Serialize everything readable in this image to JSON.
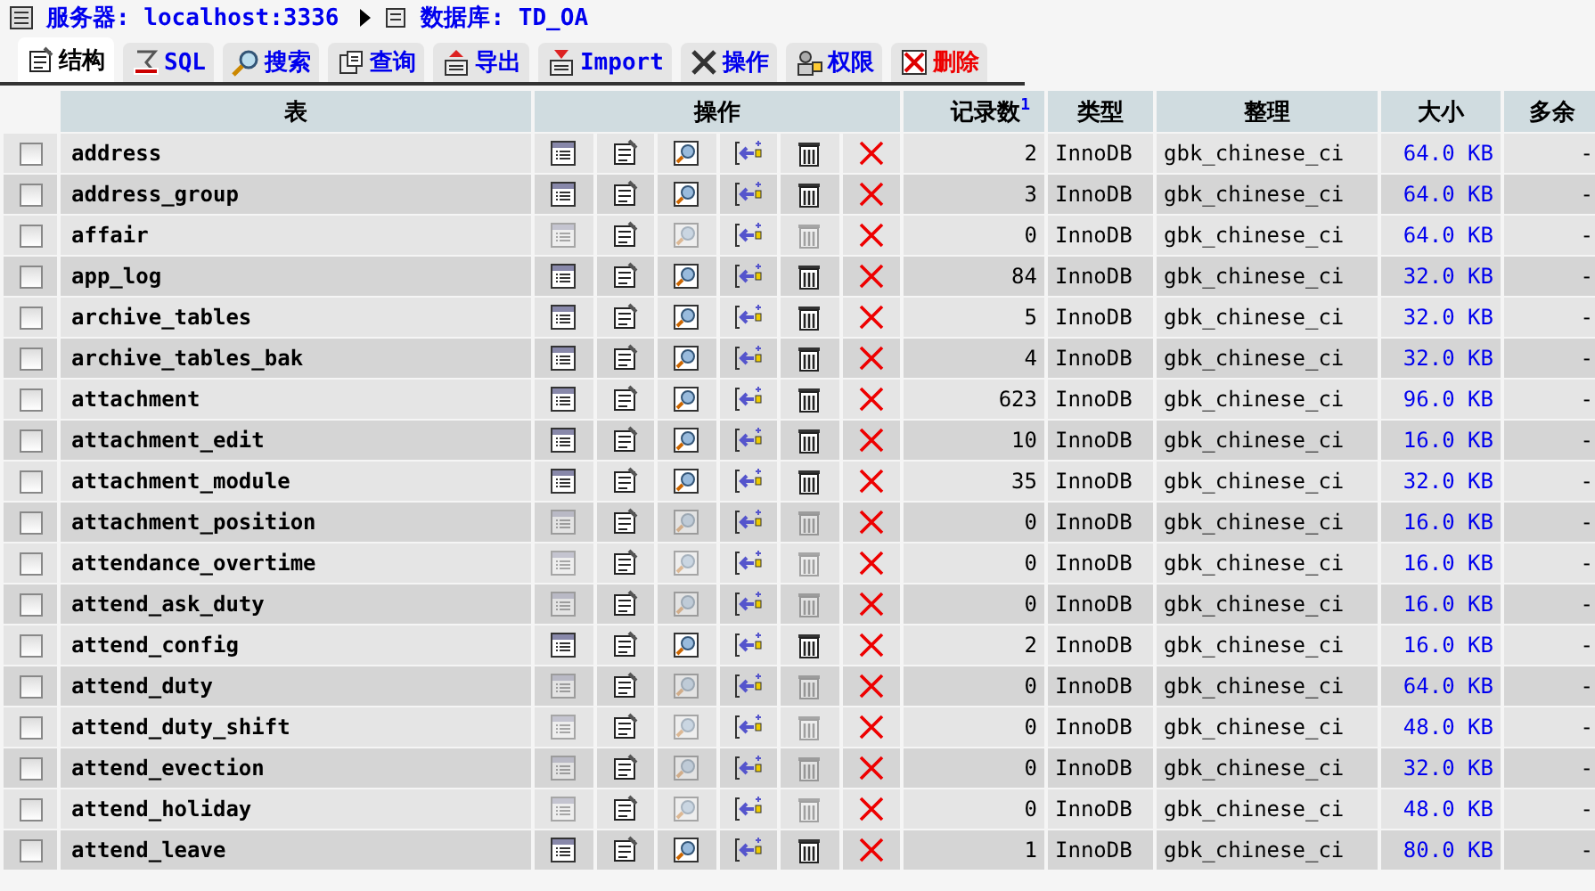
{
  "breadcrumb": {
    "server_label": "服务器: localhost:3336",
    "database_label": "数据库: TD_OA"
  },
  "tabs": [
    {
      "label": "结构",
      "selected": true,
      "kind": "structure"
    },
    {
      "label": "SQL",
      "selected": false,
      "kind": "sql"
    },
    {
      "label": "搜索",
      "selected": false,
      "kind": "search"
    },
    {
      "label": "查询",
      "selected": false,
      "kind": "query"
    },
    {
      "label": "导出",
      "selected": false,
      "kind": "export"
    },
    {
      "label": "Import",
      "selected": false,
      "kind": "import"
    },
    {
      "label": "操作",
      "selected": false,
      "kind": "operations"
    },
    {
      "label": "权限",
      "selected": false,
      "kind": "privileges"
    },
    {
      "label": "删除",
      "selected": false,
      "kind": "drop"
    }
  ],
  "table": {
    "columns": [
      {
        "label": "表"
      },
      {
        "label": "操作"
      },
      {
        "label": "记录数",
        "note": "1"
      },
      {
        "label": "类型"
      },
      {
        "label": "整理"
      },
      {
        "label": "大小"
      },
      {
        "label": "多余"
      }
    ],
    "rows": [
      {
        "name": "address",
        "checked": false,
        "empty": false,
        "records": "2",
        "type": "InnoDB",
        "collation": "gbk_chinese_ci",
        "size": "64.0 KB",
        "overhead": "-"
      },
      {
        "name": "address_group",
        "checked": false,
        "empty": false,
        "records": "3",
        "type": "InnoDB",
        "collation": "gbk_chinese_ci",
        "size": "64.0 KB",
        "overhead": "-"
      },
      {
        "name": "affair",
        "checked": false,
        "empty": true,
        "records": "0",
        "type": "InnoDB",
        "collation": "gbk_chinese_ci",
        "size": "64.0 KB",
        "overhead": "-"
      },
      {
        "name": "app_log",
        "checked": false,
        "empty": false,
        "records": "84",
        "type": "InnoDB",
        "collation": "gbk_chinese_ci",
        "size": "32.0 KB",
        "overhead": "-"
      },
      {
        "name": "archive_tables",
        "checked": false,
        "empty": false,
        "records": "5",
        "type": "InnoDB",
        "collation": "gbk_chinese_ci",
        "size": "32.0 KB",
        "overhead": "-"
      },
      {
        "name": "archive_tables_bak",
        "checked": false,
        "empty": false,
        "records": "4",
        "type": "InnoDB",
        "collation": "gbk_chinese_ci",
        "size": "32.0 KB",
        "overhead": "-"
      },
      {
        "name": "attachment",
        "checked": false,
        "empty": false,
        "records": "623",
        "type": "InnoDB",
        "collation": "gbk_chinese_ci",
        "size": "96.0 KB",
        "overhead": "-"
      },
      {
        "name": "attachment_edit",
        "checked": false,
        "empty": false,
        "records": "10",
        "type": "InnoDB",
        "collation": "gbk_chinese_ci",
        "size": "16.0 KB",
        "overhead": "-"
      },
      {
        "name": "attachment_module",
        "checked": false,
        "empty": false,
        "records": "35",
        "type": "InnoDB",
        "collation": "gbk_chinese_ci",
        "size": "32.0 KB",
        "overhead": "-"
      },
      {
        "name": "attachment_position",
        "checked": false,
        "empty": true,
        "records": "0",
        "type": "InnoDB",
        "collation": "gbk_chinese_ci",
        "size": "16.0 KB",
        "overhead": "-"
      },
      {
        "name": "attendance_overtime",
        "checked": false,
        "empty": true,
        "records": "0",
        "type": "InnoDB",
        "collation": "gbk_chinese_ci",
        "size": "16.0 KB",
        "overhead": "-"
      },
      {
        "name": "attend_ask_duty",
        "checked": false,
        "empty": true,
        "records": "0",
        "type": "InnoDB",
        "collation": "gbk_chinese_ci",
        "size": "16.0 KB",
        "overhead": "-"
      },
      {
        "name": "attend_config",
        "checked": false,
        "empty": false,
        "records": "2",
        "type": "InnoDB",
        "collation": "gbk_chinese_ci",
        "size": "16.0 KB",
        "overhead": "-"
      },
      {
        "name": "attend_duty",
        "checked": false,
        "empty": true,
        "records": "0",
        "type": "InnoDB",
        "collation": "gbk_chinese_ci",
        "size": "64.0 KB",
        "overhead": "-"
      },
      {
        "name": "attend_duty_shift",
        "checked": false,
        "empty": true,
        "records": "0",
        "type": "InnoDB",
        "collation": "gbk_chinese_ci",
        "size": "48.0 KB",
        "overhead": "-"
      },
      {
        "name": "attend_evection",
        "checked": false,
        "empty": true,
        "records": "0",
        "type": "InnoDB",
        "collation": "gbk_chinese_ci",
        "size": "32.0 KB",
        "overhead": "-"
      },
      {
        "name": "attend_holiday",
        "checked": false,
        "empty": true,
        "records": "0",
        "type": "InnoDB",
        "collation": "gbk_chinese_ci",
        "size": "48.0 KB",
        "overhead": "-"
      },
      {
        "name": "attend_leave",
        "checked": false,
        "empty": false,
        "records": "1",
        "type": "InnoDB",
        "collation": "gbk_chinese_ci",
        "size": "80.0 KB",
        "overhead": "-"
      }
    ]
  }
}
